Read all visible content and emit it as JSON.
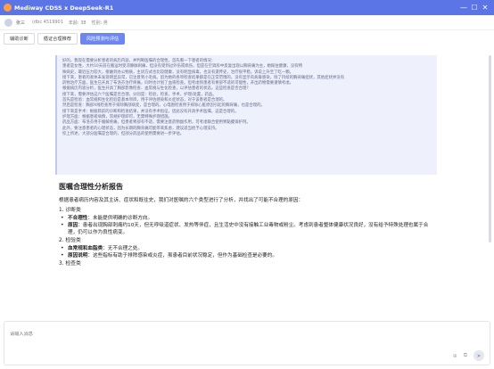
{
  "window": {
    "title": "Mediway CDSS x DeepSeek-R1",
    "minimize_glyph": "—",
    "maximize_glyph": "☐",
    "close_glyph": "✕"
  },
  "patient": {
    "name": "张三",
    "id_label": "(dbc 4519901",
    "age": "年龄: 38",
    "gender": "性别: 男"
  },
  "tabs": [
    {
      "label": "辅助诊断",
      "active": false
    },
    {
      "label": "循证合理推荐",
      "active": false
    },
    {
      "label": "风险预测与评估",
      "active": true
    }
  ],
  "reasoning": {
    "lines": [
      "好的，我现在需要分析患者的病历内容，并判断医嘱的合理性，首先看一下患者的情况：",
      "患者是女性，大约10天前在搬运时受凉静脉刺痛，但没有受到过外伤或损伤，但是在空调房中反复出现以胸背痛为主，她既往健康，没有特",
      "殊病史，最近压力较大，接触到办公物质，主诉方式也比较健康，没有明显病毒，也没有遗传史，治疗很平稳，诉说上升至了吃一颗。",
      "接下来，患者的查体未发现明显异常，已注意到小毛病。因为她的各项检查结果都是在正常范围的，没有显示有病毒感染，除了持续的胸背痛症状，其他症状并没有",
      "药物治疗方面，医生已开具了布洛芬治疗疼痛，同时也计划了血液检查。但考虑到患者有胃部不适的可能性，开出药物需要谨慎考虑。",
      "根据病历内容分析，医生开具了胸部影像检查、血常规与生化检查，以评估患者的状态。这些检查是否合理？",
      "接下来，需要评估这六个医嘱是否合理，分别是：检验，检查，手术，护理/处置，药品。",
      "首先是检验：血常规和生化检验是基本项目，用于评估感染和炎症状态，对于该患者是合理的。",
      "然后是检查：胸部X线检查用于排除胸部病变，是合理的。心电图检查用于排除心脏原因引起的胸背痛，也是合理的。",
      "接下来是手术：根据目前的诊断和检查结果，并没有手术指征，因此没有开具手术医嘱，这是合理的。",
      "护理方面：根据患者病情，常规护理即可，无需特殊护理措施。",
      "药品方面：布洛芬用于缓解疼痛，但患者胃部有不适，需要注意药物副作用，可考虑联合使用胃黏膜保护剂。",
      "此外，要注意患者的心理状态，因为长期的胸背痛可能带来焦虑，建议适当给予心理支持。",
      "综上所述，大部分医嘱是合理的，但部分药品的使用需要进一步评估。"
    ]
  },
  "report": {
    "title": "医嘱合理性分析报告",
    "intro": "根据患者病历内容及其主诉、症状和既往史，我们对医嘱的六个类型进行了分析，并找出了可能不合理的原因：",
    "sections": [
      {
        "heading": "1. 诊断类",
        "bullets": [
          {
            "bold": "不合理性",
            "text": "：未能提供明确的诊断方向。"
          },
          {
            "bold": "原因",
            "text": "：患者出现胸部刺痛约10天，但无呼吸道症状、发热等伴症，且生活史中没有接触工业毒物或粉尘。考虑到患者整体健康状况良好，没有给予特殊处理也属于合理，仍可以作为良性病变。"
          }
        ]
      },
      {
        "heading": "2. 检验类",
        "bullets": [
          {
            "bold": "血常规和血脂类",
            "text": "：无不合理之处。"
          },
          {
            "bold": "原因说明",
            "text": "：这些指标有助于排除感染或炎症，虽患者目前状况稳定，但作为基础检查是必要的。"
          }
        ]
      },
      {
        "heading": "3. 检查类",
        "bullets": []
      }
    ]
  },
  "input": {
    "placeholder": "请输入消息"
  },
  "actions": {
    "attach_glyph": "⊕",
    "copy_glyph": "⧉",
    "send_glyph": "➤"
  }
}
